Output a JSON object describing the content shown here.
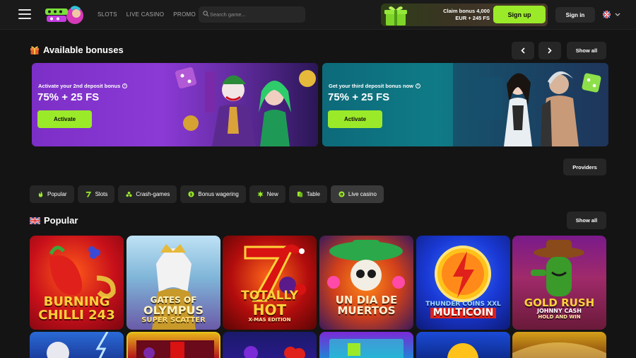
{
  "header": {
    "nav": [
      "SLOTS",
      "LIVE CASINO",
      "PROMO"
    ],
    "search_placeholder": "Search game...",
    "promo_line1": "Claim bonus 4,000",
    "promo_line2": "EUR + 245 FS",
    "signup_label": "Sign up",
    "signin_label": "Sign in"
  },
  "bonuses": {
    "title": "Available bonuses",
    "show_all": "Show all",
    "cards": [
      {
        "label": "Activate your 2nd deposit bonus",
        "amount": "75% + 25 FS",
        "button": "Activate"
      },
      {
        "label": "Get your third deposit bonus now",
        "amount": "75% + 25 FS",
        "button": "Activate"
      }
    ]
  },
  "providers_label": "Providers",
  "categories": [
    {
      "label": "Popular",
      "icon": "flame-icon"
    },
    {
      "label": "Slots",
      "icon": "seven-icon"
    },
    {
      "label": "Crash-games",
      "icon": "crash-icon"
    },
    {
      "label": "Bonus wagering",
      "icon": "bonus-icon"
    },
    {
      "label": "New",
      "icon": "new-icon"
    },
    {
      "label": "Table",
      "icon": "table-icon"
    },
    {
      "label": "Live casino",
      "icon": "live-icon"
    }
  ],
  "popular": {
    "title": "Popular",
    "show_all": "Show all",
    "games": [
      {
        "line1": "BURNING",
        "line2": "CHILLI 243"
      },
      {
        "line1": "GATES OF",
        "line2": "OLYMPUS",
        "line3": "SUPER SCATTER"
      },
      {
        "line1": "TOTALLY",
        "line2": "HOT",
        "line3": "X-MAS EDITION"
      },
      {
        "line1": "UN DIA DE",
        "line2": "MUERTOS"
      },
      {
        "line1": "THUNDER COINS XXL",
        "line2": "MULTICOIN"
      },
      {
        "line1": "GOLD RUSH",
        "line2": "JOHNNY CASH",
        "line3": "HOLD AND WIN"
      }
    ]
  },
  "colors": {
    "accent": "#9bea2a",
    "bg": "#141414",
    "panel": "#262626"
  }
}
